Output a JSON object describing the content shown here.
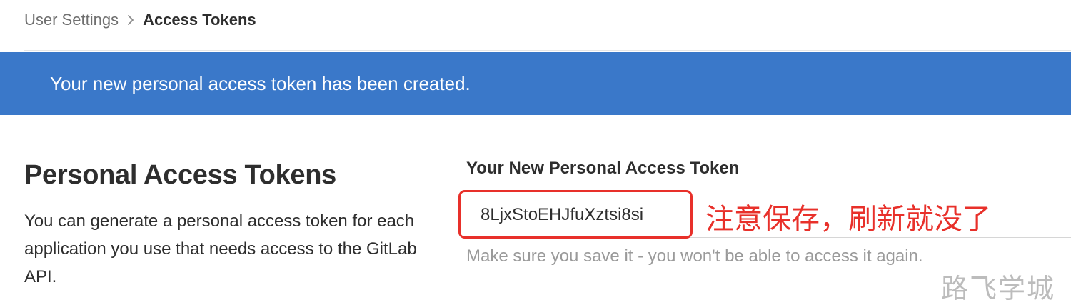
{
  "breadcrumb": {
    "parent": "User Settings",
    "separator_icon": "chevron-right-icon",
    "current": "Access Tokens"
  },
  "flash": {
    "message": "Your new personal access token has been created.",
    "color": "#3a78c9"
  },
  "section": {
    "title": "Personal Access Tokens",
    "description": "You can generate a personal access token for each application you use that needs access to the GitLab API."
  },
  "token": {
    "label": "Your New Personal Access Token",
    "value": "8LjxStoEHJfuXztsi8si",
    "help": "Make sure you save it - you won't be able to access it again."
  },
  "annotation": {
    "text": "注意保存，刷新就没了",
    "color": "#e8302a"
  },
  "watermark": {
    "text": "路飞学城"
  }
}
